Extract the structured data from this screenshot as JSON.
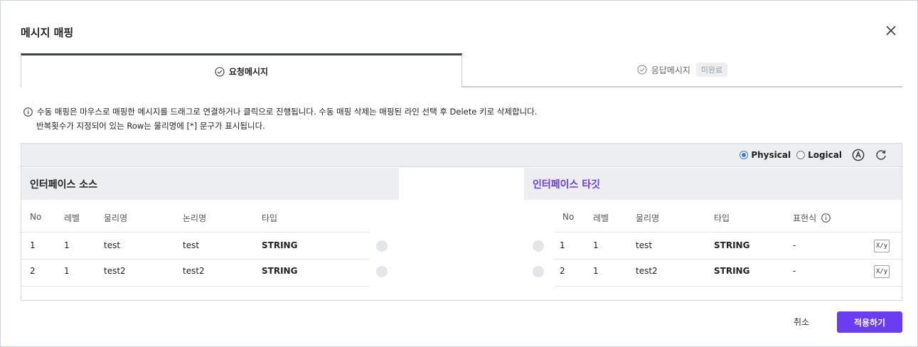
{
  "dialog": {
    "title": "메시지 매핑"
  },
  "tabs": {
    "request": {
      "label": "요청메시지"
    },
    "response": {
      "label": "응답메시지",
      "badge": "미완료"
    }
  },
  "notice": {
    "line1": "수동 매핑은 마우스로 매핑한 메시지를 드래그로 연결하거나 클릭으로 진행됩니다. 수동 매핑 삭제는 매핑된 라인 선택 후 Delete 키로 삭제합니다.",
    "line2": "반복횟수가 지정되어 있는 Row는 물리명에 [*] 문구가 표시됩니다."
  },
  "toolbar": {
    "physical_label": "Physical",
    "logical_label": "Logical",
    "selected": "Physical"
  },
  "source": {
    "title": "인터페이스 소스",
    "columns": [
      "No",
      "레벨",
      "물리명",
      "논리명",
      "타입"
    ],
    "rows": [
      [
        "1",
        "1",
        "test",
        "test",
        "STRING"
      ],
      [
        "2",
        "1",
        "test2",
        "test2",
        "STRING"
      ]
    ]
  },
  "target": {
    "title": "인터페이스 타깃",
    "columns": [
      "No",
      "레벨",
      "물리명",
      "타입",
      "표현식"
    ],
    "rows": [
      [
        "1",
        "1",
        "test",
        "STRING",
        "-"
      ],
      [
        "2",
        "1",
        "test2",
        "STRING",
        "-"
      ]
    ],
    "expr_button_label": "X/y"
  },
  "footer": {
    "cancel_label": "취소",
    "apply_label": "적용하기"
  },
  "colors": {
    "accent": "#6a3cf2",
    "radio_selected": "#3478f6"
  }
}
